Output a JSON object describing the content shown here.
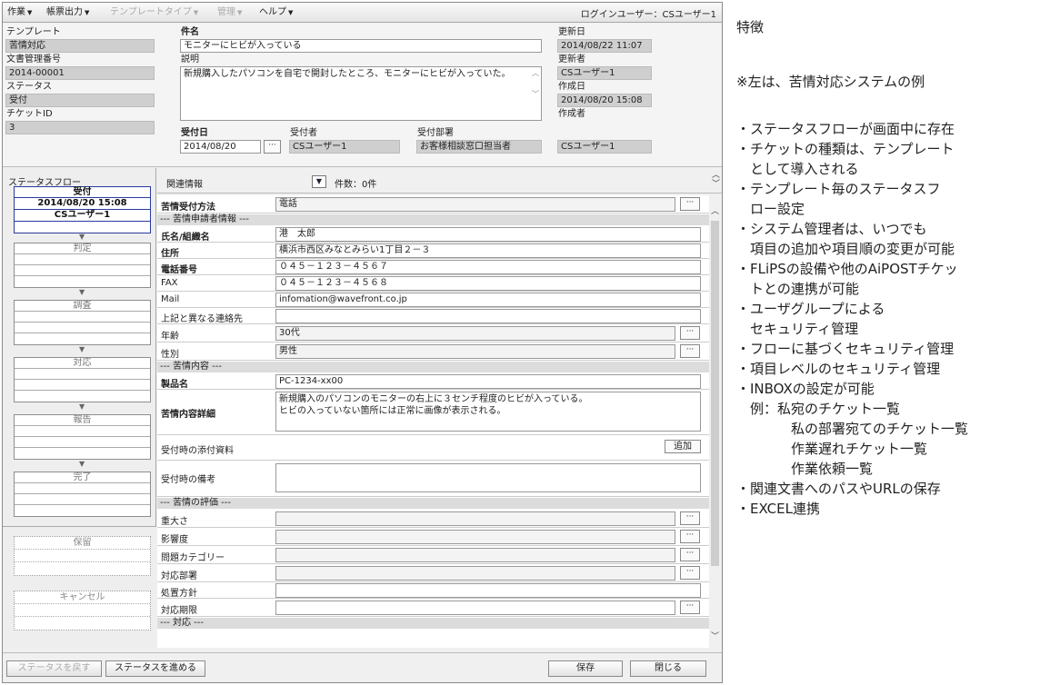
{
  "menubar": {
    "items": [
      {
        "label": "作業",
        "enabled": true
      },
      {
        "label": "帳票出力",
        "enabled": true
      },
      {
        "label": "テンプレートタイプ",
        "enabled": false
      },
      {
        "label": "管理",
        "enabled": false
      },
      {
        "label": "ヘルプ",
        "enabled": true
      }
    ],
    "login": "ログインユーザー：CSユーザー1"
  },
  "header": {
    "template_label": "テンプレート",
    "template_value": "苦情対応",
    "docno_label": "文書管理番号",
    "docno_value": "2014-00001",
    "status_label": "ステータス",
    "status_value": "受付",
    "ticket_label": "チケットID",
    "ticket_value": "3",
    "subject_label": "件名",
    "subject_value": "モニターにヒビが入っている",
    "desc_label": "説明",
    "desc_value": "新規購入したパソコンを自宅で開封したところ、モニターにヒビが入っていた。",
    "recvdate_label": "受付日",
    "recvdate_value": "2014/08/20",
    "receiver_label": "受付者",
    "receiver_value": "CSユーザー1",
    "dept_label": "受付部署",
    "dept_value": "お客様相談窓口担当者",
    "updated_label": "更新日",
    "updated_value": "2014/08/22 11:07",
    "updater_label": "更新者",
    "updater_value": "CSユーザー1",
    "created_label": "作成日",
    "created_value": "2014/08/20 15:08",
    "creator_label": "作成者",
    "creator_value": "CSユーザー1",
    "more_btn": "···"
  },
  "flow": {
    "title": "ステータスフロー",
    "current": {
      "name": "受付",
      "datetime": "2014/08/20 15:08",
      "user": "CSユーザー1"
    },
    "steps": [
      "判定",
      "調査",
      "対応",
      "報告",
      "完了"
    ],
    "arrow": "▼",
    "hold": "保留",
    "cancel": "キャンセル"
  },
  "related": {
    "label": "関連情報",
    "toggle": "▼",
    "count": "件数：0件"
  },
  "form": {
    "method_label": "苦情受付方法",
    "method_value": "電話",
    "sec_applicant": "--- 苦情申請者情報 ---",
    "name_label": "氏名/組織名",
    "name_value": "港　太郎",
    "address_label": "住所",
    "address_value": "横浜市西区みなとみらい1丁目２－３",
    "tel_label": "電話番号",
    "tel_value": "０４５－１２３－４５６７",
    "fax_label": "FAX",
    "fax_value": "０４５－１２３－４５６８",
    "mail_label": "Mail",
    "mail_value": "infomation@wavefront.co.jp",
    "altcontact_label": "上記と異なる連絡先",
    "altcontact_value": "",
    "age_label": "年齢",
    "age_value": "30代",
    "sex_label": "性別",
    "sex_value": "男性",
    "sec_content": "--- 苦情内容 ---",
    "product_label": "製品名",
    "product_value": "PC-1234-xx00",
    "detail_label": "苦情内容詳細",
    "detail_value": "新規購入のパソコンのモニターの右上に３センチ程度のヒビが入っている。\nヒビの入っていない箇所には正常に画像が表示される。",
    "attach_label": "受付時の添付資料",
    "attach_btn": "追加",
    "memo_label": "受付時の備考",
    "sec_eval": "--- 苦情の評価 ---",
    "severity_label": "重大さ",
    "impact_label": "影響度",
    "category_label": "問題カテゴリー",
    "handledept_label": "対応部署",
    "policy_label": "処置方針",
    "deadline_label": "対応期限",
    "sec_response": "--- 対応 ---",
    "more_btn": "···"
  },
  "bottom": {
    "back_btn": "ステータスを戻す",
    "advance_btn": "ステータスを進める",
    "save_btn": "保存",
    "close_btn": "閉じる"
  },
  "notes": {
    "title": "特徴",
    "subtitle": "※左は、苦情対応システムの例",
    "lines": [
      "・ステータスフローが画面中に存在",
      "・チケットの種類は、テンプレート",
      "　として導入される",
      "・テンプレート毎のステータスフ",
      "　ロー設定",
      "・システム管理者は、いつでも",
      "　項目の追加や項目順の変更が可能",
      "・FLiPSの設備や他のAiPOSTチケッ",
      "　トとの連携が可能",
      "・ユーザグループによる",
      "　セキュリティ管理",
      "・フローに基づくセキュリティ管理",
      "・項目レベルのセキュリティ管理",
      "・INBOXの設定が可能",
      "　例：私宛のチケット一覧",
      "　　　　私の部署宛てのチケット一覧",
      "　　　　作業遅れチケット一覧",
      "　　　　作業依頼一覧",
      "・関連文書へのパスやURLの保存",
      "・EXCEL連携"
    ]
  }
}
